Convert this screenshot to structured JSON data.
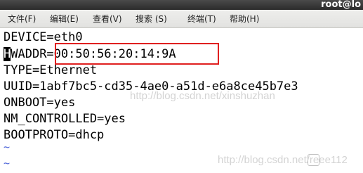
{
  "window": {
    "title": "root@lo"
  },
  "menu": [
    {
      "label": "文件(F)"
    },
    {
      "label": "编辑(E)"
    },
    {
      "label": "查看(V)"
    },
    {
      "label": "搜索 (S)"
    },
    {
      "label": "终端(T)"
    },
    {
      "label": "帮助(H)"
    }
  ],
  "terminal": {
    "lines": [
      "DEVICE=eth0",
      "WADDR=00:50:56:20:14:9A",
      "TYPE=Ethernet",
      "UUID=1abf7bc5-cd35-4ae0-a51d-e6a8ce45b7e3",
      "ONBOOT=yes",
      "NM_CONTROLLED=yes",
      "BOOTPROTO=dhcp"
    ],
    "cursor_char": "H",
    "tilde": "~"
  },
  "watermarks": {
    "center": "http://blog.csdn.net/xinshuzhan",
    "bottom": "http://blog.csdn.net/reee112"
  },
  "colors": {
    "highlight_box": "#e02020",
    "tilde": "#4a62d8",
    "titlebar": "#2b2b2b"
  }
}
